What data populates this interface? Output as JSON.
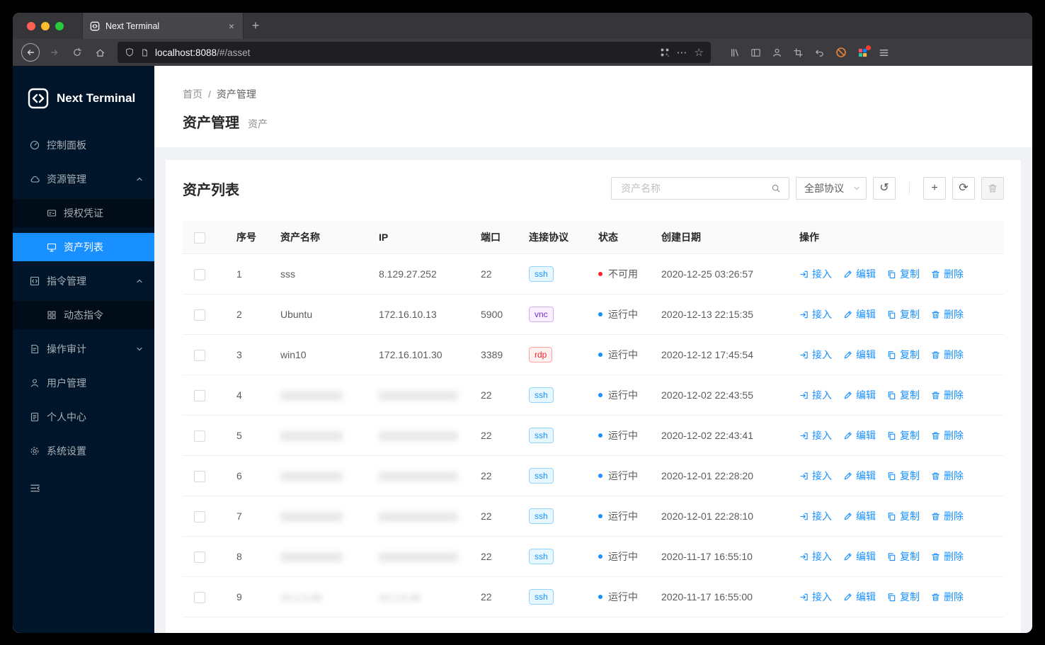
{
  "colors": {
    "accent": "#1890ff",
    "sidebar_bg": "#001529",
    "submenu_bg": "#000c17",
    "content_bg": "#f0f2f5",
    "tag_ssh": "#1890ff",
    "tag_vnc": "#722ed1",
    "tag_rdp": "#f5222d",
    "status_running": "#1890ff",
    "status_error": "#f5222d"
  },
  "icons_glyphs": {
    "new_tab": "+",
    "close_tab": "×",
    "page_actions": "⋯",
    "bookmark_star": "☆",
    "reset": "↺",
    "sync": "⟳",
    "add": "+"
  },
  "browser": {
    "tab_title": "Next Terminal",
    "url_host": "localhost:8088",
    "url_path": "/#/asset"
  },
  "sidebar": {
    "logo_text": "Next Terminal",
    "items": [
      {
        "label": "控制面板",
        "icon": "dashboard-icon"
      },
      {
        "label": "资源管理",
        "icon": "cloud-icon",
        "state": "expanded"
      },
      {
        "label": "授权凭证",
        "icon": "credential-icon",
        "submenu": true
      },
      {
        "label": "资产列表",
        "icon": "desktop-icon",
        "submenu": true,
        "active": true
      },
      {
        "label": "指令管理",
        "icon": "code-icon",
        "state": "expanded"
      },
      {
        "label": "动态指令",
        "icon": "block-icon",
        "submenu": true
      },
      {
        "label": "操作审计",
        "icon": "audit-icon",
        "state": "collapsed"
      },
      {
        "label": "用户管理",
        "icon": "user-icon"
      },
      {
        "label": "个人中心",
        "icon": "profile-icon"
      },
      {
        "label": "系统设置",
        "icon": "gear-icon"
      }
    ]
  },
  "breadcrumb": {
    "home": "首页",
    "separator": "/",
    "current": "资产管理"
  },
  "page": {
    "title": "资产管理",
    "subtitle": "资产"
  },
  "card": {
    "title": "资产列表",
    "search_placeholder": "资产名称",
    "protocol_filter": "全部协议"
  },
  "table": {
    "columns": [
      "序号",
      "资产名称",
      "IP",
      "端口",
      "连接协议",
      "状态",
      "创建日期",
      "操作"
    ],
    "actions": [
      "接入",
      "编辑",
      "复制",
      "删除"
    ],
    "rows": [
      {
        "no": "1",
        "name": "sss",
        "ip": "8.129.27.252",
        "port": "22",
        "protocol": "ssh",
        "status": "不可用",
        "status_type": "error",
        "created": "2020-12-25 03:26:57"
      },
      {
        "no": "2",
        "name": "Ubuntu",
        "ip": "172.16.10.13",
        "port": "5900",
        "protocol": "vnc",
        "status": "运行中",
        "status_type": "running",
        "created": "2020-12-13 22:15:35"
      },
      {
        "no": "3",
        "name": "win10",
        "ip": "172.16.101.30",
        "port": "3389",
        "protocol": "rdp",
        "status": "运行中",
        "status_type": "running",
        "created": "2020-12-12 17:45:54"
      },
      {
        "no": "4",
        "name": "",
        "ip": "",
        "blurred": true,
        "port": "22",
        "protocol": "ssh",
        "status": "运行中",
        "status_type": "running",
        "created": "2020-12-02 22:43:55"
      },
      {
        "no": "5",
        "name": "",
        "ip": "",
        "blurred": true,
        "port": "22",
        "protocol": "ssh",
        "status": "运行中",
        "status_type": "running",
        "created": "2020-12-02 22:43:41"
      },
      {
        "no": "6",
        "name": "",
        "ip": "",
        "blurred": true,
        "port": "22",
        "protocol": "ssh",
        "status": "运行中",
        "status_type": "running",
        "created": "2020-12-01 22:28:20"
      },
      {
        "no": "7",
        "name": "",
        "ip": "",
        "blurred": true,
        "port": "22",
        "protocol": "ssh",
        "status": "运行中",
        "status_type": "running",
        "created": "2020-12-01 22:28:10"
      },
      {
        "no": "8",
        "name": "",
        "ip": "",
        "blurred": true,
        "port": "22",
        "protocol": "ssh",
        "status": "运行中",
        "status_type": "running",
        "created": "2020-11-17 16:55:10"
      },
      {
        "no": "9",
        "name": "10.1.5.49",
        "ip": "10.1.5.49",
        "blurred": true,
        "port": "22",
        "protocol": "ssh",
        "status": "运行中",
        "status_type": "running",
        "created": "2020-11-17 16:55:00"
      }
    ]
  }
}
